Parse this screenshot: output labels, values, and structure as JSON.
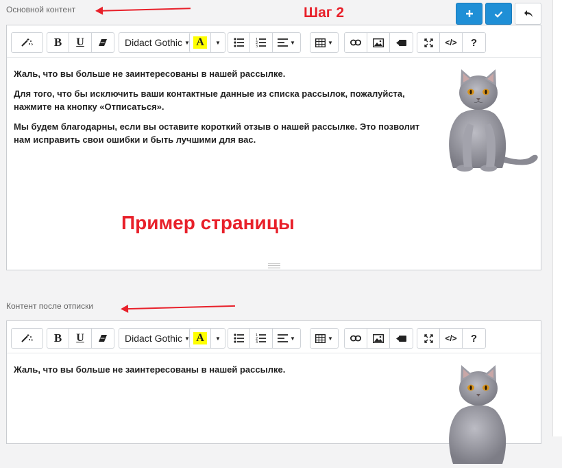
{
  "labels": {
    "main_content": "Основной контент",
    "after_unsub": "Контент после отписки"
  },
  "annotations": {
    "step": "Шаг 2",
    "example": "Пример страницы"
  },
  "toolbar": {
    "font_name": "Didact Gothic",
    "bold": "B",
    "underline": "U",
    "highlight": "A",
    "help": "?",
    "code": "</>"
  },
  "editor1": {
    "paragraphs": [
      "Жаль, что вы больше не заинтересованы в нашей рассылке.",
      "Для того, что бы исключить ваши контактные данные из списка рассылок, пожалуйста, нажмите на кнопку «Отписаться».",
      "Мы будем благодарны, если вы оставите короткий отзыв о нашей рассылке. Это позволит нам исправить свои ошибки и быть лучшими для вас."
    ]
  },
  "editor2": {
    "paragraphs": [
      "Жаль, что вы больше не заинтересованы в нашей рассылке."
    ]
  },
  "icons": {
    "add": "plus-icon",
    "confirm": "check-icon",
    "back": "reply-icon",
    "magic": "magic-wand-icon",
    "eraser": "eraser-icon",
    "list": "list-icon",
    "ordered_list": "ordered-list-icon",
    "align": "align-icon",
    "table": "table-icon",
    "link": "link-icon",
    "image": "image-icon",
    "video": "video-icon",
    "fullscreen": "fullscreen-icon",
    "code": "code-icon",
    "help": "help-icon",
    "cat_picture": "cat-image"
  },
  "colors": {
    "accent_blue": "#1f8fd6",
    "annotation_red": "#e8202a",
    "highlight_yellow": "#ffff00"
  }
}
